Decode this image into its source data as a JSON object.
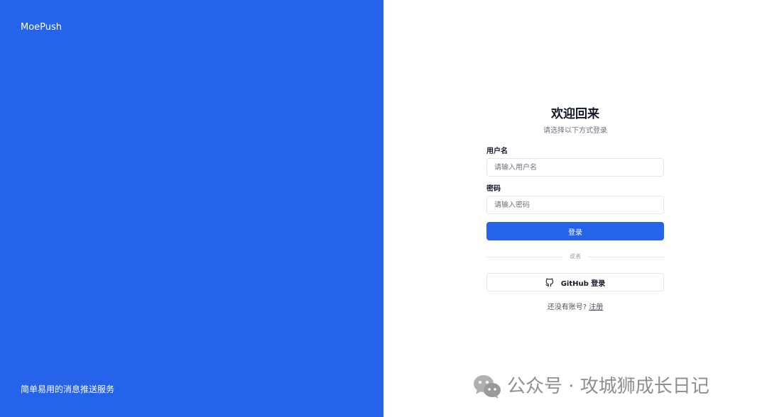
{
  "brand": {
    "name": "MoePush",
    "tagline": "简单易用的消息推送服务",
    "color": "#2563eb"
  },
  "login": {
    "title": "欢迎回来",
    "subtitle": "请选择以下方式登录",
    "username_label": "用户名",
    "username_placeholder": "请输入用户名",
    "username_value": "",
    "password_label": "密码",
    "password_placeholder": "请输入密码",
    "password_value": "",
    "submit_label": "登录",
    "divider_text": "或者",
    "github_label": "GitHub 登录",
    "github_icon": "github-icon",
    "no_account_text": "还没有账号?",
    "register_label": "注册"
  },
  "watermark": {
    "icon": "wechat-icon",
    "text": "公众号 · 攻城狮成长日记"
  }
}
